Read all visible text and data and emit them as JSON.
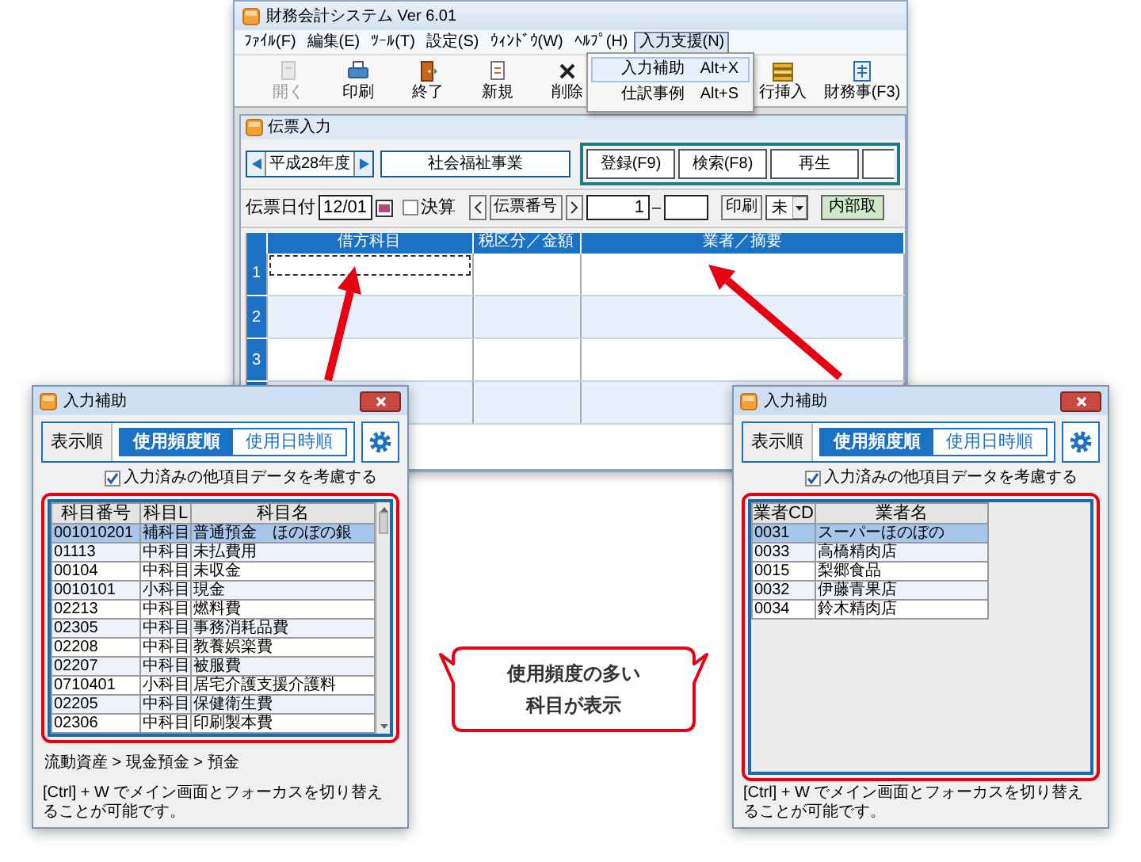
{
  "main_window": {
    "title": "財務会計システム  Ver 6.01",
    "menu": [
      {
        "label": "ﾌｧｲﾙ(F)",
        "selected": false
      },
      {
        "label": "編集(E)",
        "selected": false
      },
      {
        "label": "ﾂｰﾙ(T)",
        "selected": false
      },
      {
        "label": "設定(S)",
        "selected": false
      },
      {
        "label": "ｳｨﾝﾄﾞｳ(W)",
        "selected": false
      },
      {
        "label": "ﾍﾙﾌﾟ(H)",
        "selected": false
      },
      {
        "label": "入力支援(N)",
        "selected": true
      }
    ],
    "toolbar": [
      {
        "kind": "open",
        "label": "開く",
        "disabled": true
      },
      {
        "kind": "print",
        "label": "印刷",
        "disabled": false
      },
      {
        "kind": "exit",
        "label": "終了",
        "disabled": false
      },
      {
        "kind": "new",
        "label": "新規",
        "disabled": false
      },
      {
        "kind": "delete",
        "label": "削除",
        "disabled": false
      },
      {
        "kind": "insert",
        "label": "行挿入",
        "disabled": false
      },
      {
        "kind": "report",
        "label": "財務事(F3)",
        "disabled": false
      }
    ],
    "dropdown": [
      {
        "label": "入力補助",
        "shortcut": "Alt+X",
        "selected": true
      },
      {
        "label": "仕訳事例",
        "shortcut": "Alt+S",
        "selected": false
      }
    ],
    "child_window": {
      "title": "伝票入力",
      "fiscal_year": "平成28年度",
      "business": "社会福祉事業",
      "buttons": [
        "登録(F9)",
        "検索(F8)",
        "再生"
      ],
      "date_label": "伝票日付",
      "date": "12/01",
      "closing": {
        "label": "決算",
        "checked": false
      },
      "voucher_label": "伝票番号",
      "voucher_from": "1",
      "range_separator": "–",
      "print_label": "印刷",
      "print_value": "未",
      "internal": "内部取",
      "grid": {
        "columns": [
          "借方科目",
          "税区分／金額",
          "業者／摘要"
        ],
        "row_numbers": [
          "1",
          "2",
          "3"
        ]
      }
    }
  },
  "dialogs": [
    {
      "title": "入力補助",
      "sort_label": "表示順",
      "sort_options": [
        {
          "label": "使用頻度順",
          "selected": true
        },
        {
          "label": "使用日時順",
          "selected": false
        }
      ],
      "consider": {
        "label": "入力済みの他項目データを考慮する",
        "checked": true
      },
      "table": {
        "columns": [
          "科目番号",
          "科目L",
          "科目名"
        ],
        "rows": [
          {
            "cells": [
              "001010201",
              "補科目",
              "普通預金　ほのぼの銀"
            ],
            "selected": true
          },
          {
            "cells": [
              "01113",
              "中科目",
              "未払費用"
            ],
            "selected": false
          },
          {
            "cells": [
              "00104",
              "中科目",
              "未収金"
            ],
            "selected": false
          },
          {
            "cells": [
              "0010101",
              "小科目",
              "現金"
            ],
            "selected": false
          },
          {
            "cells": [
              "02213",
              "中科目",
              "燃料費"
            ],
            "selected": false
          },
          {
            "cells": [
              "02305",
              "中科目",
              "事務消耗品費"
            ],
            "selected": false
          },
          {
            "cells": [
              "02208",
              "中科目",
              "教養娯楽費"
            ],
            "selected": false
          },
          {
            "cells": [
              "02207",
              "中科目",
              "被服費"
            ],
            "selected": false
          },
          {
            "cells": [
              "0710401",
              "小科目",
              "居宅介護支援介護料"
            ],
            "selected": false
          },
          {
            "cells": [
              "02205",
              "中科目",
              "保健衛生費"
            ],
            "selected": false
          },
          {
            "cells": [
              "02306",
              "中科目",
              "印刷製本費"
            ],
            "selected": false
          }
        ]
      },
      "breadcrumb": "流動資産 > 現金預金 > 預金",
      "hint": "[Ctrl] + W でメイン画面とフォーカスを切り替えることが可能です。"
    },
    {
      "title": "入力補助",
      "sort_label": "表示順",
      "sort_options": [
        {
          "label": "使用頻度順",
          "selected": true
        },
        {
          "label": "使用日時順",
          "selected": false
        }
      ],
      "consider": {
        "label": "入力済みの他項目データを考慮する",
        "checked": true
      },
      "table": {
        "columns": [
          "業者CD",
          "業者名"
        ],
        "rows": [
          {
            "cells": [
              "0031",
              "スーパーほのぼの"
            ],
            "selected": true
          },
          {
            "cells": [
              "0033",
              "高橋精肉店"
            ],
            "selected": false
          },
          {
            "cells": [
              "0015",
              "梨郷食品"
            ],
            "selected": false
          },
          {
            "cells": [
              "0032",
              "伊藤青果店"
            ],
            "selected": false
          },
          {
            "cells": [
              "0034",
              "鈴木精肉店"
            ],
            "selected": false
          }
        ]
      },
      "hint": "[Ctrl] + W でメイン画面とフォーカスを切り替えることが可能です。"
    }
  ],
  "callout": {
    "lines": [
      "使用頻度の多い",
      "科目が表示"
    ]
  }
}
